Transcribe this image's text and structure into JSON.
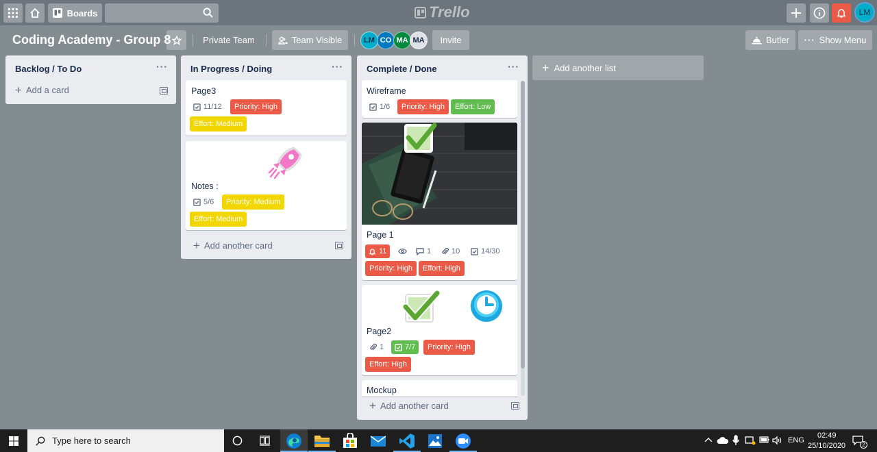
{
  "header": {
    "boards_label": "Boards",
    "logo_text": "Trello",
    "user_initials": "LM"
  },
  "board": {
    "title": "Coding Academy - Group 8",
    "team_button": "Private Team",
    "visibility_button": "Team Visible",
    "members": [
      {
        "initials": "LM",
        "color": "#00aecc"
      },
      {
        "initials": "CO",
        "color": "#0079bf"
      },
      {
        "initials": "MA",
        "color": "#008a3e"
      },
      {
        "initials": "MA",
        "color": "#dfe1e6"
      }
    ],
    "invite_label": "Invite",
    "butler_label": "Butler",
    "show_menu_label": "Show Menu"
  },
  "lists": [
    {
      "title": "Backlog / To Do",
      "add_card": "Add a card"
    },
    {
      "title": "In Progress / Doing",
      "add_card": "Add another card",
      "cards": [
        {
          "title": "Page3",
          "checklist": "11/12",
          "labels": [
            "Priority: High",
            "Effort: Medium"
          ]
        },
        {
          "title": "Notes :",
          "checklist": "5/6",
          "labels": [
            "Priority: Medium",
            "Effort: Medium"
          ]
        }
      ]
    },
    {
      "title": "Complete / Done",
      "add_card": "Add another card",
      "cards": [
        {
          "title": "Wireframe",
          "checklist": "1/6",
          "labels": [
            "Priority: High",
            "Effort: Low"
          ]
        },
        {
          "title": "Page 1",
          "notifications": "11",
          "comments": "1",
          "attachments": "10",
          "checklist": "14/30",
          "labels": [
            "Priority: High",
            "Effort: High"
          ]
        },
        {
          "title": "Page2",
          "attachments": "1",
          "checklist": "7/7",
          "labels": [
            "Priority: High",
            "Effort: High"
          ]
        },
        {
          "title": "Mockup"
        }
      ]
    }
  ],
  "add_list": "Add another list",
  "colors": {
    "label_red": "#eb5a46",
    "label_yellow": "#f2d600",
    "label_green": "#61bd4f",
    "board_bg": "#838c91"
  },
  "taskbar": {
    "search_placeholder": "Type here to search",
    "language": "ENG",
    "time": "02:49",
    "date": "25/10/2020",
    "notification_count": "2"
  }
}
